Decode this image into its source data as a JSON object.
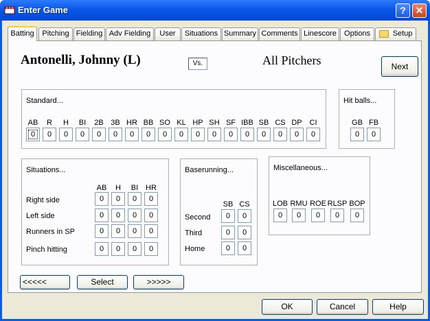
{
  "window": {
    "title": "Enter Game",
    "help_glyph": "?",
    "close_glyph": "✕"
  },
  "tabs": [
    "Batting",
    "Pitching",
    "Fielding",
    "Adv Fielding",
    "User",
    "Situations",
    "Summary",
    "Comments",
    "Linescore",
    "Options",
    "Setup"
  ],
  "header": {
    "player": "Antonelli, Johnny (L)",
    "vs": "Vs.",
    "pitchers": "All Pitchers",
    "next_label": "Next"
  },
  "standard": {
    "title": "Standard...",
    "headers": [
      "AB",
      "R",
      "H",
      "BI",
      "2B",
      "3B",
      "HR",
      "BB",
      "SO",
      "KL",
      "HP",
      "SH",
      "SF",
      "IBB",
      "SB",
      "CS",
      "DP",
      "CI"
    ],
    "values": [
      "0",
      "0",
      "0",
      "0",
      "0",
      "0",
      "0",
      "0",
      "0",
      "0",
      "0",
      "0",
      "0",
      "0",
      "0",
      "0",
      "0",
      "0"
    ]
  },
  "hitballs": {
    "title": "Hit balls...",
    "headers": [
      "GB",
      "FB"
    ],
    "values": [
      "0",
      "0"
    ]
  },
  "situations": {
    "title": "Situations...",
    "headers": [
      "AB",
      "H",
      "BI",
      "HR"
    ],
    "rows": [
      {
        "label": "Right side",
        "values": [
          "0",
          "0",
          "0",
          "0"
        ]
      },
      {
        "label": "Left side",
        "values": [
          "0",
          "0",
          "0",
          "0"
        ]
      },
      {
        "label": "Runners in SP",
        "values": [
          "0",
          "0",
          "0",
          "0"
        ]
      },
      {
        "label": "Pinch hitting",
        "values": [
          "0",
          "0",
          "0",
          "0"
        ]
      }
    ]
  },
  "baserunning": {
    "title": "Baserunning...",
    "headers": [
      "SB",
      "CS"
    ],
    "rows": [
      {
        "label": "Second",
        "values": [
          "0",
          "0"
        ]
      },
      {
        "label": "Third",
        "values": [
          "0",
          "0"
        ]
      },
      {
        "label": "Home",
        "values": [
          "0",
          "0"
        ]
      }
    ]
  },
  "misc": {
    "title": "Miscellaneous...",
    "headers": [
      "LOB",
      "RMU",
      "ROE",
      "RLSP",
      "BOP"
    ],
    "values": [
      "0",
      "0",
      "0",
      "0",
      "0"
    ]
  },
  "nav": {
    "prev": "<<<<<",
    "select": "Select",
    "next": ">>>>>"
  },
  "footer": {
    "ok": "OK",
    "cancel": "Cancel",
    "help": "Help"
  }
}
